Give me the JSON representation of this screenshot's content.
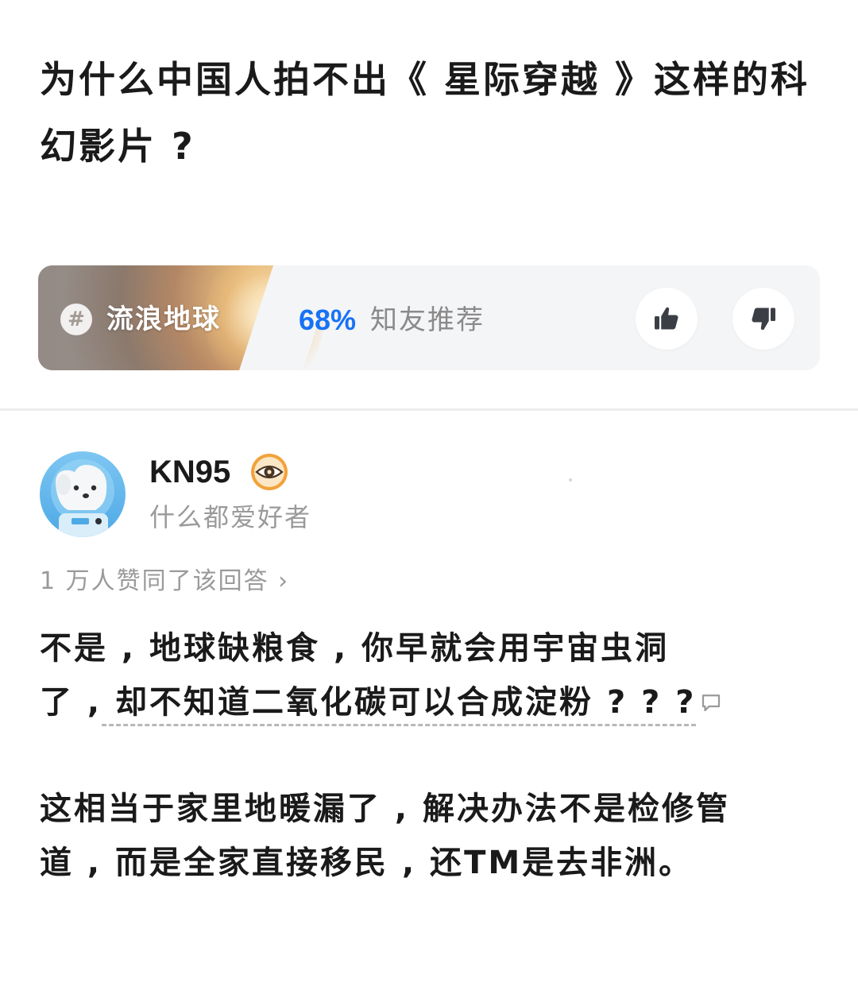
{
  "question": {
    "title": "为什么中国人拍不出《 星际穿越 》这样的科幻影片 ?"
  },
  "movie_card": {
    "tag_icon": "#",
    "movie_name": "流浪地球",
    "rating_percent": "68%",
    "rating_label": "知友推荐",
    "thumbs_up_icon": "thumbs-up-icon",
    "thumbs_down_icon": "thumbs-down-icon",
    "accent_color": "#1772f6"
  },
  "author": {
    "name": "KN95",
    "bio": "什么都爱好者",
    "badge_icon": "eye-badge-icon"
  },
  "answer": {
    "upvote_summary": "1 万人赞同了该回答 ›",
    "paragraph_1_line_1": "不是 , 地球缺粮食 , 你早就会用宇宙虫洞",
    "paragraph_1_line_2_prefix": "了 ,",
    "paragraph_1_line_2_highlight": " 却不知道二氧化碳可以合成淀粉 ? ? ?",
    "paragraph_2_line_1": "这相当于家里地暖漏了 , 解决办法不是检修管",
    "paragraph_2_line_2": "道 , 而是全家直接移民 , 还TM是去非洲。"
  }
}
